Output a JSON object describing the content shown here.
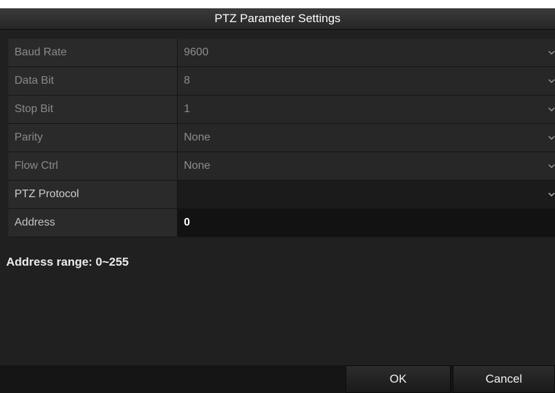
{
  "dialog": {
    "title": "PTZ Parameter Settings",
    "fields": [
      {
        "label": "Baud Rate",
        "value": "9600"
      },
      {
        "label": "Data Bit",
        "value": "8"
      },
      {
        "label": "Stop Bit",
        "value": "1"
      },
      {
        "label": "Parity",
        "value": "None"
      },
      {
        "label": "Flow Ctrl",
        "value": "None"
      },
      {
        "label": "PTZ Protocol",
        "value": ""
      },
      {
        "label": "Address",
        "value": "0"
      }
    ],
    "hint": "Address range: 0~255",
    "buttons": {
      "ok": "OK",
      "cancel": "Cancel"
    }
  },
  "colors": {
    "background": "#202020",
    "title_text": "#ffffff",
    "dim_text": "#8a8a8a"
  }
}
